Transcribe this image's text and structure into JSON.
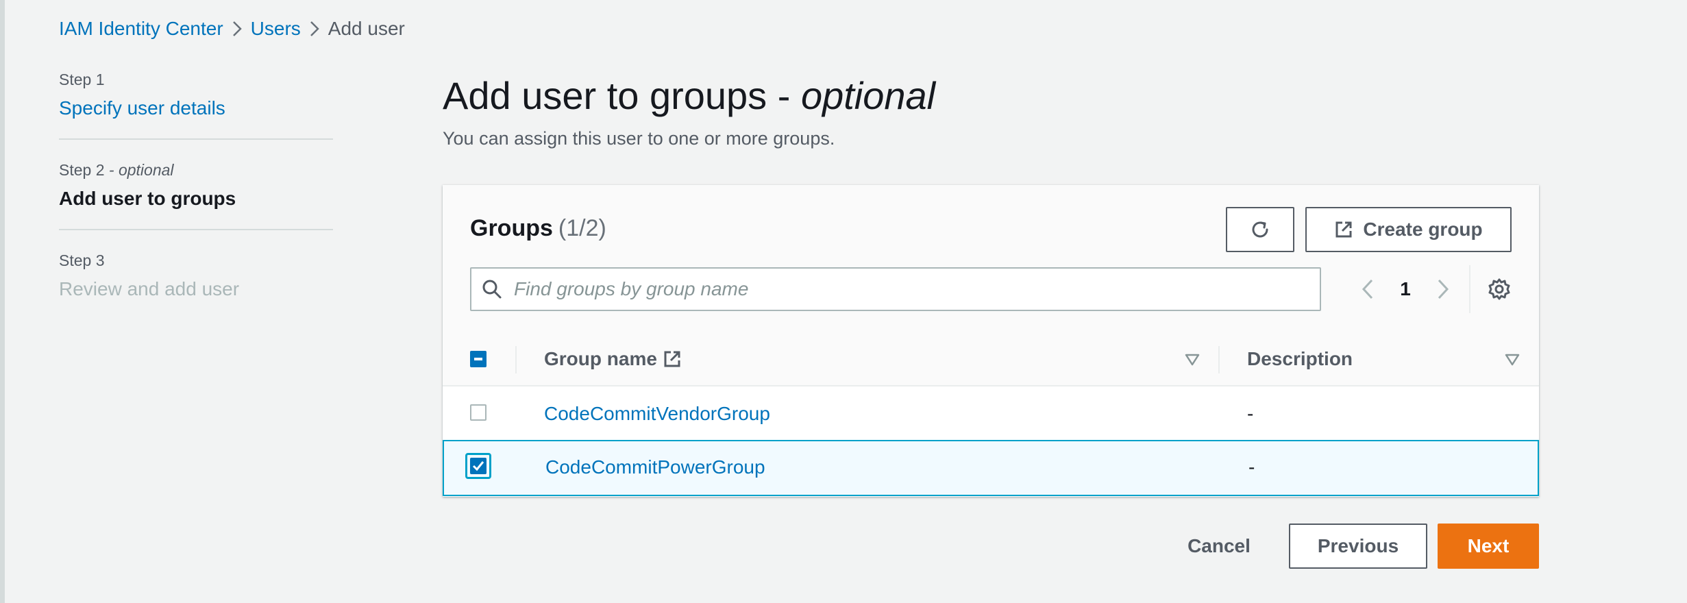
{
  "breadcrumb": {
    "items": [
      "IAM Identity Center",
      "Users",
      "Add user"
    ]
  },
  "steps": [
    {
      "label": "Step 1",
      "title": "Specify user details",
      "state": "link"
    },
    {
      "label": "Step 2",
      "label_optional": "- optional",
      "title": "Add user to groups",
      "state": "active"
    },
    {
      "label": "Step 3",
      "title": "Review and add user",
      "state": "disabled"
    }
  ],
  "page": {
    "title": "Add user to groups -",
    "title_optional": "optional",
    "description": "You can assign this user to one or more groups."
  },
  "groups_panel": {
    "title": "Groups",
    "count": "(1/2)",
    "refresh_icon": "refresh-icon",
    "create_label": "Create group",
    "create_icon": "external-link-icon",
    "search_placeholder": "Find groups by group name",
    "search_value": "",
    "page_number": "1"
  },
  "table": {
    "columns": [
      "Group name",
      "Description"
    ],
    "header_checkbox_state": "indeterminate",
    "rows": [
      {
        "name": "CodeCommitVendorGroup",
        "description": "-",
        "selected": false
      },
      {
        "name": "CodeCommitPowerGroup",
        "description": "-",
        "selected": true
      }
    ]
  },
  "footer": {
    "cancel": "Cancel",
    "previous": "Previous",
    "next": "Next"
  },
  "colors": {
    "link": "#0073bb",
    "primary_button": "#ec7211",
    "selection_border": "#00a1c9",
    "background": "#f2f3f3"
  }
}
